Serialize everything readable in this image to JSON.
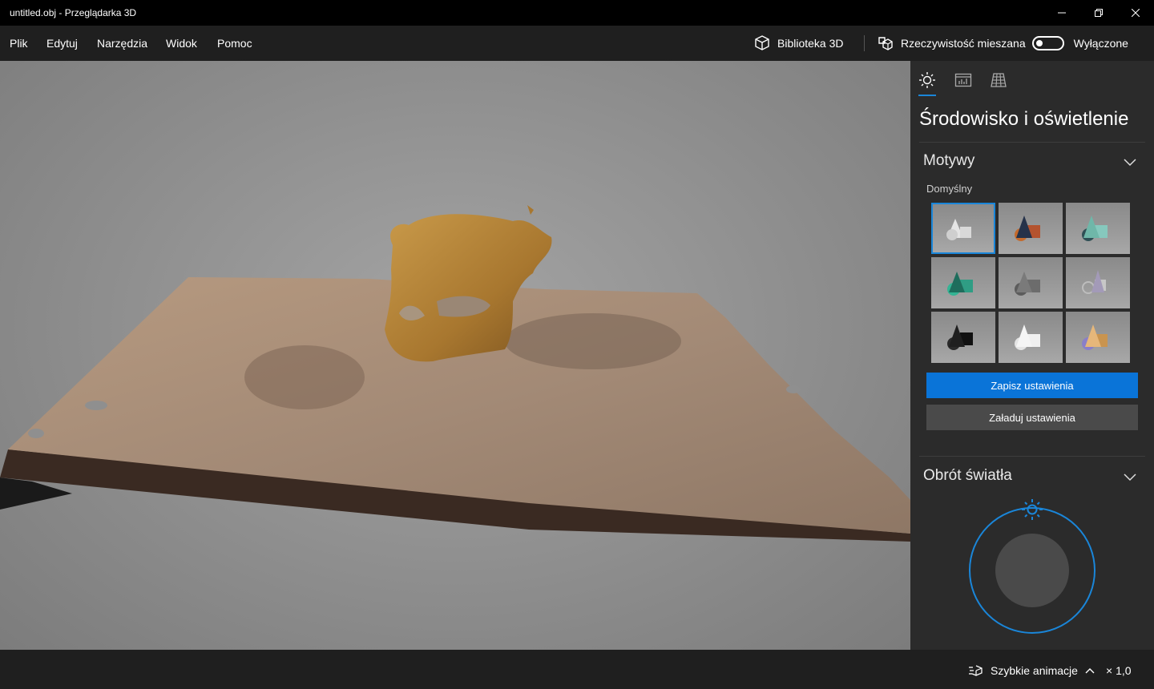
{
  "window": {
    "title": "untitled.obj - Przeglądarka 3D"
  },
  "menu": {
    "items": [
      "Plik",
      "Edytuj",
      "Narzędzia",
      "Widok",
      "Pomoc"
    ],
    "library_label": "Biblioteka 3D",
    "mixed_reality_label": "Rzeczywistość mieszana",
    "toggle_state_label": "Wyłączone"
  },
  "panel": {
    "title": "Środowisko i oświetlenie",
    "themes_section": {
      "title": "Motywy",
      "subtitle": "Domyślny",
      "tiles": [
        {
          "name": "theme-default",
          "accent": "#dcdcdc",
          "selected": true
        },
        {
          "name": "theme-warm",
          "accent": "#b4532f"
        },
        {
          "name": "theme-teal",
          "accent": "#6fb7a9"
        },
        {
          "name": "theme-green",
          "accent": "#2f9d84"
        },
        {
          "name": "theme-gray",
          "accent": "#6c6c6c"
        },
        {
          "name": "theme-lavender",
          "accent": "#a39ab8"
        },
        {
          "name": "theme-dark",
          "accent": "#1f1f1f"
        },
        {
          "name": "theme-white",
          "accent": "#f0f0f0"
        },
        {
          "name": "theme-pastel",
          "accent": "#c9944f"
        }
      ]
    },
    "save_button": "Zapisz ustawienia",
    "load_button": "Załaduj ustawienia",
    "light_section": {
      "title": "Obrót światła"
    }
  },
  "status": {
    "animation_label": "Szybkie animacje",
    "zoom_label": "× 1,0"
  },
  "colors": {
    "accent": "#0a74d8",
    "panel_bg": "#2b2b2b",
    "titlebar_bg": "#000000"
  }
}
